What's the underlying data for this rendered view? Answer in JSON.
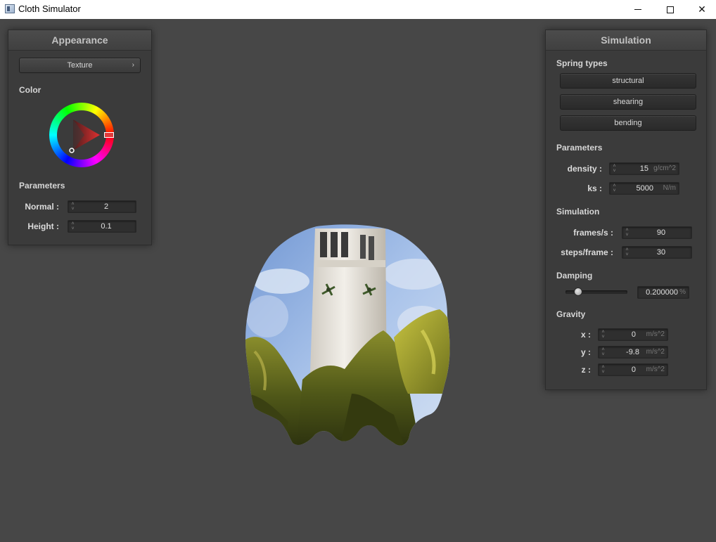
{
  "window": {
    "title": "Cloth Simulator",
    "min_label": "–",
    "close_label": "✕"
  },
  "appearance": {
    "title": "Appearance",
    "shader_button": "Texture",
    "shader_chevron": "›",
    "color_label": "Color",
    "color_value": "#d33333",
    "parameters_label": "Parameters",
    "normal": {
      "label": "Normal :",
      "value": "2"
    },
    "height": {
      "label": "Height :",
      "value": "0.1"
    }
  },
  "simulation_panel": {
    "title": "Simulation",
    "spring_types_label": "Spring types",
    "spring_buttons": [
      "structural",
      "shearing",
      "bending"
    ],
    "parameters_label": "Parameters",
    "density": {
      "label": "density :",
      "value": "15",
      "unit": "g/cm^2"
    },
    "ks": {
      "label": "ks :",
      "value": "5000",
      "unit": "N/m"
    },
    "simulation_label": "Simulation",
    "fps": {
      "label": "frames/s :",
      "value": "90"
    },
    "steps": {
      "label": "steps/frame :",
      "value": "30"
    },
    "damping_label": "Damping",
    "damping": {
      "value": "0.200000",
      "unit": "%",
      "slider_fraction": 0.2
    },
    "gravity_label": "Gravity",
    "gravity": [
      {
        "label": "x :",
        "value": "0",
        "unit": "m/s^2"
      },
      {
        "label": "y :",
        "value": "-9.8",
        "unit": "m/s^2"
      },
      {
        "label": "z :",
        "value": "0",
        "unit": "m/s^2"
      }
    ]
  },
  "colors": {
    "background": "#474747",
    "panel": "#3b3b3b",
    "sky": "#8fb1e0",
    "foliage": "#8a8a2c",
    "tower": "#e8e4dc"
  }
}
